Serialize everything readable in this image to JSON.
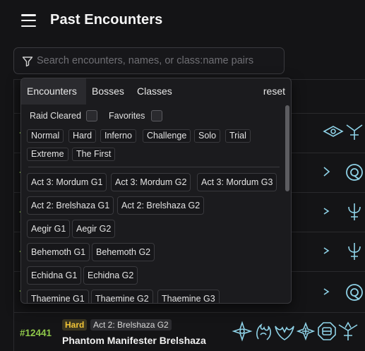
{
  "header": {
    "title": "Past Encounters"
  },
  "search": {
    "placeholder": "Search encounters, names, or class:name pairs",
    "value": ""
  },
  "filter_panel": {
    "tabs": [
      {
        "label": "Encounters",
        "active": true
      },
      {
        "label": "Bosses",
        "active": false
      },
      {
        "label": "Classes",
        "active": false
      }
    ],
    "reset_label": "reset",
    "checkboxes": [
      {
        "label": "Raid Cleared",
        "checked": false
      },
      {
        "label": "Favorites",
        "checked": false
      }
    ],
    "difficulties": [
      "Normal",
      "Hard",
      "Inferno",
      "Challenge",
      "Solo",
      "Trial",
      "Extreme",
      "The First"
    ],
    "raids": [
      "Act 3: Mordum G1",
      "Act 3: Mordum G2",
      "Act 3: Mordum G3",
      "Act 2: Brelshaza G1",
      "Act 2: Brelshaza G2",
      "Aegir G1",
      "Aegir G2",
      "Behemoth G1",
      "Behemoth G2",
      "Echidna G1",
      "Echidna G2",
      "Thaemine G1",
      "Thaemine G2",
      "Thaemine G3"
    ]
  },
  "encounters": [
    {
      "id": "#12441",
      "difficulty": "Hard",
      "raid": "Act 2: Brelshaza G2",
      "boss": "Phantom Manifester Brelshaza",
      "class_icons": [
        "class-icon-1",
        "class-icon-2",
        "class-icon-3",
        "class-icon-4",
        "class-icon-5",
        "class-icon-6"
      ]
    }
  ],
  "colors": {
    "accent_id": "#8fc84a",
    "hard_badge": "#f2c537",
    "icon_glow": "#8fd3e8"
  }
}
